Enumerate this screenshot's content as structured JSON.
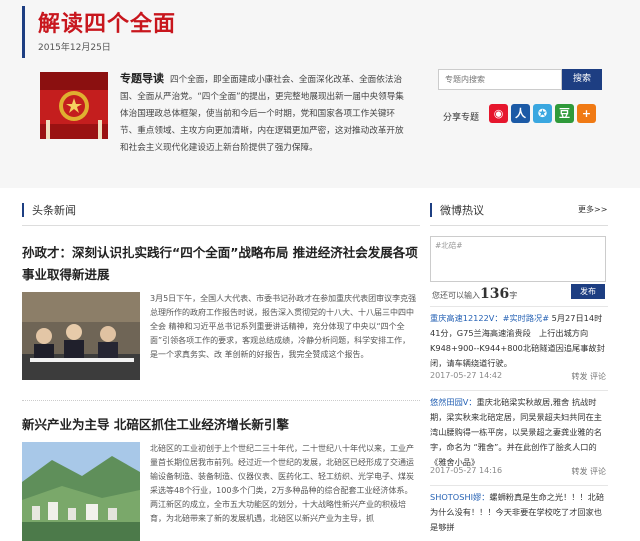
{
  "header": {
    "title": "解读四个全面",
    "date": "2015年12月25日"
  },
  "topic": {
    "label": "专题导读",
    "text": "四个全面，即全面建成小康社会、全面深化改革、全面依法治国、全面从严治党。“四个全面”的提出，更完整地展现出新一届中央领导集体治国理政总体框架，使当前和今后一个时期，党和国家各项工作关键环节、重点领域、主攻方向更加清晰，内在逻辑更加严密，这对推动改革开放和社会主义现代化建设迈上新台阶提供了强力保障。"
  },
  "search": {
    "placeholder": "专题内搜索",
    "button": "搜索"
  },
  "share": {
    "label": "分享专题",
    "icons": [
      "weibo-icon",
      "renren-icon",
      "qzone-icon",
      "douban-icon",
      "plus-icon"
    ]
  },
  "headline": {
    "section_title": "头条新闻",
    "items": [
      {
        "title": "孙政才：深刻认识扎实践行“四个全面”战略布局 推进经济社会发展各项事业取得新进展",
        "text": "3月5日下午，全国人大代表、市委书记孙政才在参加重庆代表团审议李克强总理所作的政府工作报告时说，报告深入贯彻党的十八大、十八届三中四中全会 精神和习近平总书记系列重要讲话精神，充分体现了中央以“四个全面”引领各项工作的要求，客观总结成绩，冷静分析问题，科学安排工作，是一个求真务实、改 革创新的好报告，我完全赞成这个报告。"
      },
      {
        "title": "新兴产业为主导 北碚区抓住工业经济增长新引擎",
        "text": "北碚区的工业初创于上个世纪二三十年代，二十世纪八十年代以来，工业产量首长期位居我市前列。经过近一个世纪的发展，北碚区已经形成了交通运输设备制造、装备制造、仪器仪表、医药化工、轻工纺织、光学电子、煤炭采选等48个行业，100多个门类，2万多种品种的综合配套工业经济体系。两江新区的成立，全市五大功能区的划分，十大战略性新兴产业的积极培育，为北碚带来了新的发展机遇，北碚区以新兴产业为主导，抓"
      }
    ]
  },
  "weibo": {
    "section_title": "微博热议",
    "more": "更多>>",
    "input_value": "#北碚#",
    "count_prefix": "您还可以输入",
    "count_number": "136",
    "count_suffix": "字",
    "post_button": "发布",
    "posts": [
      {
        "user": "重庆高速12122V：#实时路况#",
        "text": " 5月27日14时41分，G75兰海高速渝贵段　上行出城方向K948+900--K944+800北碚隧道因追尾事故封闭，请车辆绕道行驶。",
        "time": "2017-05-27 14:42",
        "actions": "转发  评论"
      },
      {
        "user": "悠然田园V：",
        "text": "重庆北碚梁实秋故居,雅舍 抗战时期，梁实秋来北碚定居，同吴景超夫妇共同在主湾山腰购得一栋平房，以吴景超之妻龚业雅的名字，命名为 “雅舍”。并在此创作了脍炙人口的《雅舍小品》",
        "time": "2017-05-27 14:16",
        "actions": "转发  评论"
      },
      {
        "user": "SHOTOSHI嫪：",
        "text": "螺蛳粉真是生命之光！！！北碚为什么没有！！！今天非要在学校吃了才回家也是够拼",
        "time": "",
        "actions": ""
      }
    ]
  },
  "colors": {
    "title_red": "#c8161d",
    "nav_blue": "#1d3e82",
    "link_blue": "#2763b5"
  }
}
